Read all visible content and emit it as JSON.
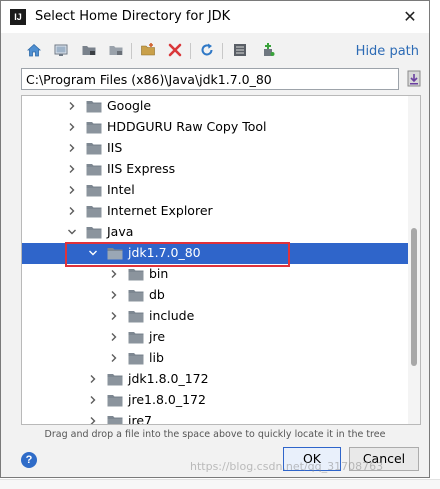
{
  "dialog": {
    "title": "Select Home Directory for JDK",
    "app_icon_text": "IJ",
    "close_glyph": "✕"
  },
  "toolbar": {
    "buttons": [
      "home-icon",
      "desktop-icon",
      "project-icon",
      "module-icon",
      "new-folder-icon",
      "delete-icon",
      "refresh-icon",
      "show-hidden-icon",
      "add-library-icon"
    ],
    "hide_path_label": "Hide path"
  },
  "path_field": {
    "value": "C:\\Program Files (x86)\\Java\\jdk1.7.0_80"
  },
  "tree": {
    "rows": [
      {
        "label": "Google",
        "level": 0,
        "expanded": false,
        "selected": false
      },
      {
        "label": "HDDGURU Raw Copy Tool",
        "level": 0,
        "expanded": false,
        "selected": false
      },
      {
        "label": "IIS",
        "level": 0,
        "expanded": false,
        "selected": false
      },
      {
        "label": "IIS Express",
        "level": 0,
        "expanded": false,
        "selected": false
      },
      {
        "label": "Intel",
        "level": 0,
        "expanded": false,
        "selected": false
      },
      {
        "label": "Internet Explorer",
        "level": 0,
        "expanded": false,
        "selected": false
      },
      {
        "label": "Java",
        "level": 0,
        "expanded": true,
        "selected": false
      },
      {
        "label": "jdk1.7.0_80",
        "level": 1,
        "expanded": true,
        "selected": true
      },
      {
        "label": "bin",
        "level": 2,
        "expanded": false,
        "selected": false
      },
      {
        "label": "db",
        "level": 2,
        "expanded": false,
        "selected": false
      },
      {
        "label": "include",
        "level": 2,
        "expanded": false,
        "selected": false
      },
      {
        "label": "jre",
        "level": 2,
        "expanded": false,
        "selected": false
      },
      {
        "label": "lib",
        "level": 2,
        "expanded": false,
        "selected": false
      },
      {
        "label": "jdk1.8.0_172",
        "level": 1,
        "expanded": false,
        "selected": false
      },
      {
        "label": "jre1.8.0_172",
        "level": 1,
        "expanded": false,
        "selected": false
      },
      {
        "label": "jre7",
        "level": 1,
        "expanded": false,
        "selected": false
      }
    ]
  },
  "hint": "Drag and drop a file into the space above to quickly locate it in the tree",
  "help_glyph": "?",
  "buttons": {
    "ok": "OK",
    "cancel": "Cancel"
  },
  "watermark": "https://blog.csdn.net/qq_31708763",
  "colors": {
    "selection": "#2f65ca",
    "link": "#2d6bb5",
    "highlight": "#e0323a",
    "folder": "#7d8791"
  }
}
